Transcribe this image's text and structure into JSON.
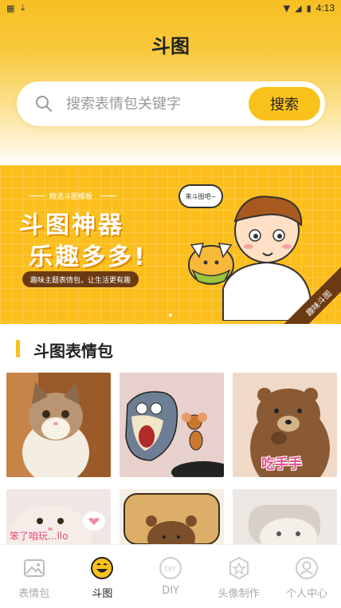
{
  "status_bar": {
    "time": "4:13"
  },
  "header": {
    "title": "斗图"
  },
  "search": {
    "placeholder": "搜索表情包关键字",
    "button_label": "搜索"
  },
  "banner": {
    "subtitle": "精选斗图模板",
    "title_line1": "斗图神器",
    "title_line2": "乐趣多多!",
    "tagline": "趣味主题表情包，让生活更有趣",
    "speech_bubble": "来斗图吧~",
    "corner_tag": "趣味斗图"
  },
  "section": {
    "title": "斗图表情包"
  },
  "stickers": [
    {
      "caption": ""
    },
    {
      "caption": ""
    },
    {
      "caption": "吃手手"
    },
    {
      "caption": "笨了咱玩...llo"
    },
    {
      "caption": ""
    },
    {
      "caption": ""
    }
  ],
  "tabbar": {
    "items": [
      {
        "label": "表情包",
        "icon": "image-icon"
      },
      {
        "label": "斗图",
        "icon": "smile-icon"
      },
      {
        "label": "DIY",
        "icon": "diy-icon"
      },
      {
        "label": "头像制作",
        "icon": "star-badge-icon"
      },
      {
        "label": "个人中心",
        "icon": "user-icon"
      }
    ],
    "active_index": 1
  },
  "colors": {
    "accent": "#f8c21a",
    "brand_dark": "#6b3a12"
  }
}
